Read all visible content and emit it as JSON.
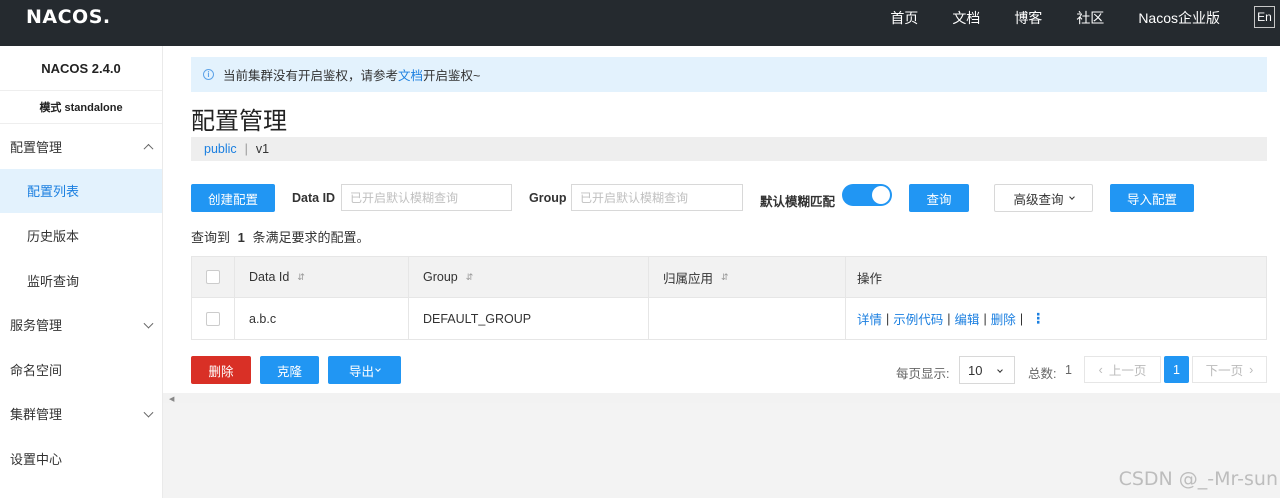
{
  "brand": {
    "logo": "NACOS."
  },
  "nav": {
    "items": [
      "首页",
      "文档",
      "博客",
      "社区",
      "Nacos企业版"
    ],
    "lang": "En"
  },
  "sidebar": {
    "version": "NACOS 2.4.0",
    "mode": "模式 standalone",
    "items": [
      {
        "label": "配置管理"
      },
      {
        "label": "配置列表"
      },
      {
        "label": "历史版本"
      },
      {
        "label": "监听查询"
      },
      {
        "label": "服务管理"
      },
      {
        "label": "命名空间"
      },
      {
        "label": "集群管理"
      },
      {
        "label": "设置中心"
      }
    ]
  },
  "notice": {
    "prefix": "当前集群没有开启鉴权，请参考",
    "link": "文档",
    "suffix": "开启鉴权~"
  },
  "page": {
    "title": "配置管理",
    "namespace": "public",
    "separator": "|",
    "tenant": "v1"
  },
  "toolbar": {
    "create_label": "创建配置",
    "dataid_label": "Data ID",
    "dataid_placeholder": "已开启默认模糊查询",
    "group_label": "Group",
    "group_placeholder": "已开启默认模糊查询",
    "fuzzy_label": "默认模糊匹配",
    "fuzzy_enabled": true,
    "search_label": "查询",
    "advanced_label": "高级查询",
    "import_label": "导入配置"
  },
  "summary": {
    "prefix": "查询到",
    "count": "1",
    "suffix": "条满足要求的配置。"
  },
  "table": {
    "headers": {
      "data_id": "Data Id",
      "group": "Group",
      "app": "归属应用",
      "ops": "操作"
    },
    "rows": [
      {
        "data_id": "a.b.c",
        "group": "DEFAULT_GROUP",
        "app": ""
      }
    ],
    "ops": {
      "detail": "详情",
      "sample": "示例代码",
      "edit": "编辑",
      "delete": "删除"
    }
  },
  "batch": {
    "delete_label": "删除",
    "clone_label": "克隆",
    "export_label": "导出"
  },
  "pager": {
    "per_page_label": "每页显示:",
    "per_page_value": "10",
    "total_label": "总数:",
    "total_value": "1",
    "prev_label": "上一页",
    "current_page": "1",
    "next_label": "下一页"
  },
  "watermark": "CSDN @_-Mr-sun",
  "colors": {
    "primary": "#2196f3",
    "danger": "#d93026",
    "topbar": "#252a2f",
    "notice_bg": "#e3f2fd"
  }
}
